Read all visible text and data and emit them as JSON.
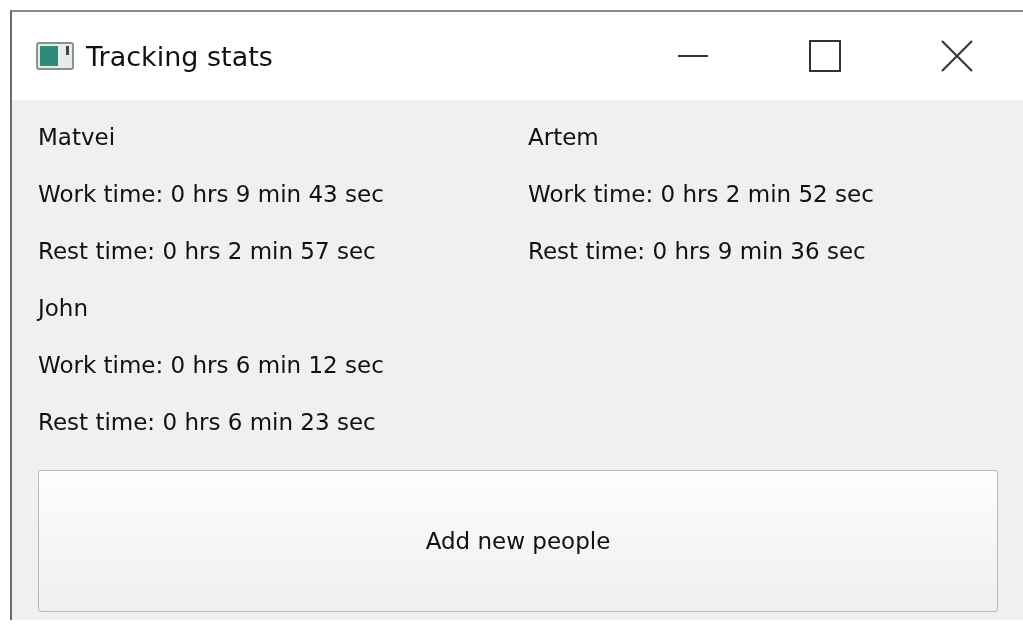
{
  "window": {
    "title": "Tracking stats"
  },
  "people": [
    {
      "name": "Matvei",
      "work": "Work time: 0 hrs 9 min 43 sec",
      "rest": "Rest time: 0 hrs 2 min 57 sec"
    },
    {
      "name": "Artem",
      "work": "Work time: 0 hrs 2 min 52 sec",
      "rest": "Rest time: 0 hrs 9 min 36 sec"
    },
    {
      "name": "John",
      "work": "Work time: 0 hrs 6 min 12 sec",
      "rest": "Rest time: 0 hrs 6 min 23 sec"
    }
  ],
  "buttons": [
    "Add new people"
  ]
}
